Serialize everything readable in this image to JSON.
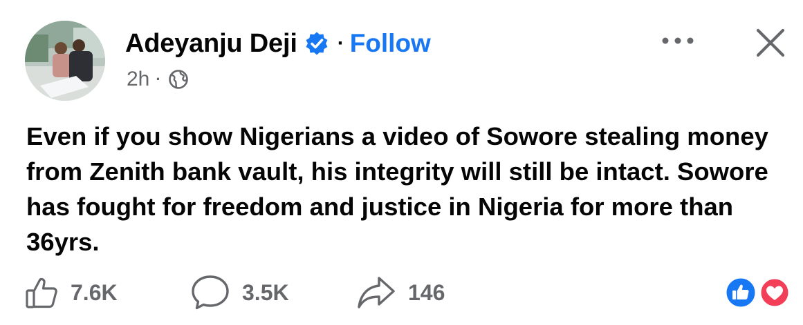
{
  "post": {
    "author": "Adeyanju Deji",
    "separator": "·",
    "follow_label": "Follow",
    "time": "2h",
    "meta_separator": "·",
    "text": "Even if you show Nigerians a video of Sowore stealing money from Zenith bank vault, his integrity will still be intact. Sowore has fought for freedom and justice in Nigeria for more than 36yrs."
  },
  "engagement": {
    "likes": "7.6K",
    "comments": "3.5K",
    "shares": "146"
  },
  "icons": {
    "verified": "verified-badge-icon",
    "privacy": "globe-icon",
    "more": "more-options-icon",
    "close": "close-icon",
    "like": "thumbs-up-icon",
    "comment": "comment-bubble-icon",
    "share": "share-arrow-icon",
    "reaction_like": "like-reaction-icon",
    "reaction_love": "love-reaction-icon"
  },
  "colors": {
    "follow": "#1877f2",
    "secondary_text": "#65676b",
    "like_reaction": "#1877f2",
    "love_reaction": "#f33e58"
  }
}
